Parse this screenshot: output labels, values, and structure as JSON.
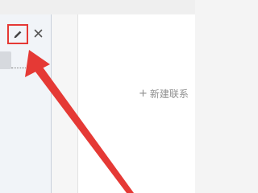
{
  "left_panel": {
    "edit_icon": "pencil-icon",
    "close_icon": "close-icon"
  },
  "right_panel": {
    "new_contact_label": "新建联系"
  },
  "annotation": {
    "color": "#e53935"
  }
}
